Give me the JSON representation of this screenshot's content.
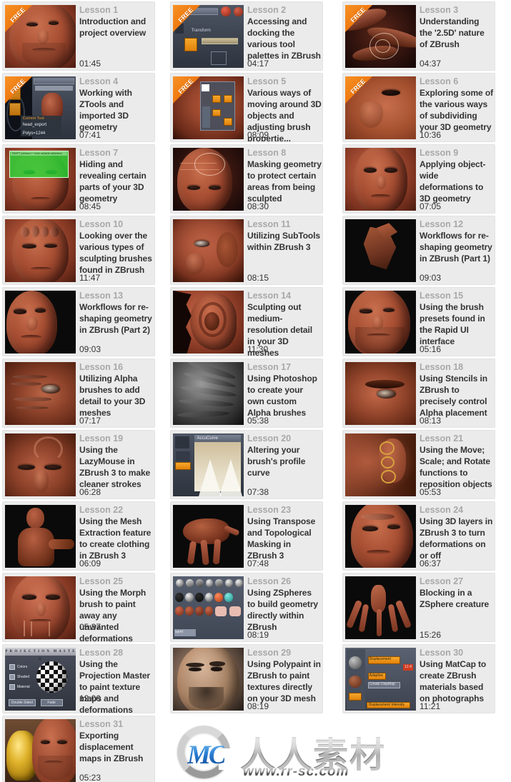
{
  "page": {
    "background_color": "#ffffff",
    "card_background_color": "#ebebeb",
    "lesson_label_color": "#a8a8a8",
    "title_color": "#333333",
    "free_badge_color": "#f07c12",
    "free_badge_label": "FREE",
    "columns": 3
  },
  "watermark": {
    "mark": "MC",
    "chinese": "人人素材",
    "url": "www.rr-sc.com"
  },
  "lessons": [
    {
      "number": "Lesson 1",
      "title": "Introduction and project overview",
      "duration": "01:45",
      "free": true,
      "art": "face-smile"
    },
    {
      "number": "Lesson 2",
      "title": "Accessing and docking the various tool palettes in ZBrush",
      "duration": "04:17",
      "free": true,
      "art": "ui-transform"
    },
    {
      "number": "Lesson 3",
      "title": "Understanding the '2.5D' nature of ZBrush",
      "duration": "04:37",
      "free": true,
      "art": "strokes-dark"
    },
    {
      "number": "Lesson 4",
      "title": "Working with ZTools and imported 3D geometry",
      "duration": "07:41",
      "free": true,
      "art": "ui-ztool"
    },
    {
      "number": "Lesson 5",
      "title": "Various ways of moving around 3D objects and adjusting brush propertie...",
      "duration": "08:09",
      "free": true,
      "art": "ui-overlay-face"
    },
    {
      "number": "Lesson 6",
      "title": "Exploring some of the various ways of subdividing your 3D geometry",
      "duration": "10:36",
      "free": true,
      "art": "nose-closeup"
    },
    {
      "number": "Lesson 7",
      "title": "Hiding and revealing certain parts of your 3D geometry",
      "duration": "08:45",
      "free": false,
      "art": "green-select"
    },
    {
      "number": "Lesson 8",
      "title": "Masking geometry to protect certain areas from being sculpted",
      "duration": "08:30",
      "free": false,
      "art": "head-mask"
    },
    {
      "number": "Lesson 9",
      "title": "Applying object-wide deformations to 3D geometry",
      "duration": "07:05",
      "free": false,
      "art": "head-front"
    },
    {
      "number": "Lesson 10",
      "title": "Looking over the various types of sculpting brushes found in ZBrush",
      "duration": "11:47",
      "free": false,
      "art": "head-brushed"
    },
    {
      "number": "Lesson 11",
      "title": "Utilizing SubTools within ZBrush 3",
      "duration": "08:15",
      "free": false,
      "art": "head-poly"
    },
    {
      "number": "Lesson 12",
      "title": "Workflows for re-shaping geometry in ZBrush (Part 1)",
      "duration": "09:03",
      "free": false,
      "art": "lowpoly-dark"
    },
    {
      "number": "Lesson 13",
      "title": "Workflows for re-shaping geometry in ZBrush (Part 2)",
      "duration": "09:03",
      "free": false,
      "art": "head-smooth"
    },
    {
      "number": "Lesson 14",
      "title": "Sculpting out medium-resolution detail in your 3D meshes",
      "duration": "11:30",
      "free": false,
      "art": "ear"
    },
    {
      "number": "Lesson 15",
      "title": "Using the brush presets found in the Rapid UI interface",
      "duration": "05:16",
      "free": false,
      "art": "face-beard"
    },
    {
      "number": "Lesson 16",
      "title": "Utilizing Alpha brushes to add detail to your 3D meshes",
      "duration": "07:17",
      "free": false,
      "art": "eye-wrinkle"
    },
    {
      "number": "Lesson 17",
      "title": "Using Photoshop to create your own custom Alpha brushes",
      "duration": "05:38",
      "free": false,
      "art": "gray-wrinkles"
    },
    {
      "number": "Lesson 18",
      "title": "Using Stencils in ZBrush to precisely control Alpha placement",
      "duration": "08:13",
      "free": false,
      "art": "eye-brow"
    },
    {
      "number": "Lesson 19",
      "title": "Using the LazyMouse in ZBrush 3 to make cleaner strokes",
      "duration": "06:28",
      "free": false,
      "art": "brow-stroke"
    },
    {
      "number": "Lesson 20",
      "title": "Altering your brush's profile curve",
      "duration": "07:38",
      "free": false,
      "art": "accucurve"
    },
    {
      "number": "Lesson 21",
      "title": "Using the Move; Scale; and Rotate functions to reposition objects",
      "duration": "05:53",
      "free": false,
      "art": "transpose-ear"
    },
    {
      "number": "Lesson 22",
      "title": "Using the Mesh Extraction feature to create clothing in ZBrush 3",
      "duration": "06:09",
      "free": false,
      "art": "torso"
    },
    {
      "number": "Lesson 23",
      "title": "Using Transpose and Topological Masking in ZBrush 3",
      "duration": "07:48",
      "free": false,
      "art": "creature"
    },
    {
      "number": "Lesson 24",
      "title": "Using 3D layers in ZBrush 3 to turn deformations on or off",
      "duration": "06:37",
      "free": false,
      "art": "head-angry"
    },
    {
      "number": "Lesson 25",
      "title": "Using the Morph brush to paint away any unwanted deformations",
      "duration": "05:37",
      "free": false,
      "art": "head-morph",
      "overlap": true
    },
    {
      "number": "Lesson 26",
      "title": "Using ZSpheres to build geometry directly within ZBrush",
      "duration": "08:19",
      "free": false,
      "art": "brush-palette"
    },
    {
      "number": "Lesson 27",
      "title": "Blocking in a ZSphere creature",
      "duration": "15:26",
      "free": false,
      "art": "zsphere-spider"
    },
    {
      "number": "Lesson 28",
      "title": "Using the Projection Master to paint texture maps and deformations",
      "duration": "12:00",
      "free": false,
      "art": "projection-master",
      "overlap": true
    },
    {
      "number": "Lesson 29",
      "title": "Using Polypaint in ZBrush to paint textures directly on your 3D mesh",
      "duration": "08:19",
      "free": false,
      "art": "polypaint-head"
    },
    {
      "number": "Lesson 30",
      "title": "Using MatCap to create ZBrush materials based on photographs",
      "duration": "11:21",
      "free": false,
      "art": "displacement-ui"
    },
    {
      "number": "Lesson 31",
      "title": "Exporting displacement maps in ZBrush",
      "duration": "05:23",
      "free": false,
      "art": "buddha-head"
    }
  ]
}
